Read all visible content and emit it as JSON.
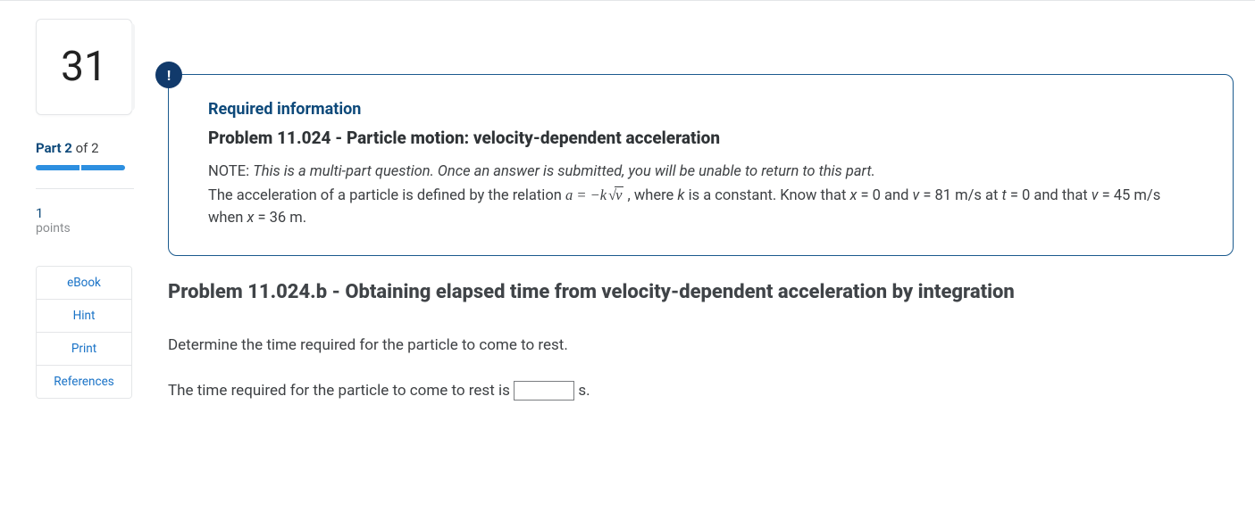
{
  "sidebar": {
    "question_number": "31",
    "part_prefix": "Part ",
    "part_current": "2",
    "part_of_word": " of ",
    "part_total": "2",
    "points_value": "1",
    "points_label": "points",
    "resources": {
      "ebook": "eBook",
      "hint": "Hint",
      "print": "Print",
      "refs": "References"
    }
  },
  "info": {
    "badge": "!",
    "required_heading": "Required information",
    "problem_title": "Problem 11.024 - Particle motion: velocity-dependent acceleration",
    "note_prefix": "NOTE: ",
    "note_italic": "This is a multi-part question. Once an answer is submitted, you will be unable to return to this part.",
    "rel_pre": "The acceleration of a particle is defined by the relation ",
    "eq_lhs_var": "a",
    "eq_eq": " = ",
    "eq_neg": "−",
    "eq_k": "k",
    "eq_radicand": "v",
    "rel_post1": " , where ",
    "rel_k": "k",
    "rel_post2": " is a constant. Know that ",
    "rel_x": "x",
    "rel_eq0": " = 0 and ",
    "rel_v": "v",
    "rel_v81": " = 81 m/s at ",
    "rel_t": "t",
    "rel_t0": " = 0 and that ",
    "rel_v2": "v",
    "rel_v45": " = 45 m/s when ",
    "rel_x2": "x",
    "rel_x36": " = 36 m."
  },
  "subproblem": {
    "title": "Problem 11.024.b - Obtaining elapsed time from velocity-dependent acceleration by integration",
    "prompt": "Determine the time required for the particle to come to rest.",
    "answer_pre": "The time required for the particle to come to rest is ",
    "answer_unit": " s.",
    "answer_value": ""
  }
}
